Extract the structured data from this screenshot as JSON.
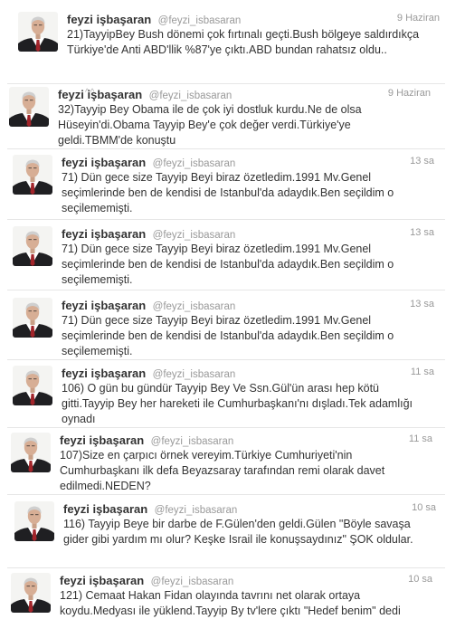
{
  "colors": {
    "name": "#333333",
    "handle": "#999999",
    "text": "#333333",
    "divider": "#e6e6e6"
  },
  "tweets": [
    {
      "name": "feyzi işbaşaran",
      "handle": "@feyzi_isbasaran",
      "time": "9 Haziran",
      "text": "21)TayyipBey Bush dönemi çok fırtınalı geçti.Bush bölgeye saldırdıkça Türkiye'de Anti ABD'llik %87'ye çıktı.ABD bundan rahatsız oldu..",
      "expand": "^^"
    },
    {
      "name": "feyzi işbaşaran",
      "handle": "@feyzi_isbasaran",
      "time": "9 Haziran",
      "text": "32)Tayyip Bey Obama ile de çok iyi dostluk kurdu.Ne de olsa Hüseyin'di.Obama Tayyip Bey'e çok değer verdi.Türkiye'ye geldi.TBMM'de konuştu"
    },
    {
      "name": "feyzi işbaşaran",
      "handle": "@feyzi_isbasaran",
      "time": "13 sa",
      "text": "71) Dün gece size Tayyip Beyi biraz özetledim.1991 Mv.Genel seçimlerinde ben de kendisi de Istanbul'da adaydık.Ben seçildim o seçilememişti."
    },
    {
      "name": "feyzi işbaşaran",
      "handle": "@feyzi_isbasaran",
      "time": "13 sa",
      "text": "71) Dün gece size Tayyip Beyi biraz özetledim.1991 Mv.Genel seçimlerinde ben de kendisi de Istanbul'da adaydık.Ben seçildim o seçilememişti."
    },
    {
      "name": "feyzi işbaşaran",
      "handle": "@feyzi_isbasaran",
      "time": "13 sa",
      "text": "71) Dün gece size Tayyip Beyi biraz özetledim.1991 Mv.Genel seçimlerinde ben de kendisi de Istanbul'da adaydık.Ben seçildim o seçilememişti."
    },
    {
      "name": "feyzi işbaşaran",
      "handle": "@feyzi_isbasaran",
      "time": "11 sa",
      "text": "106) O gün bu gündür Tayyip Bey Ve Ssn.Gül'ün arası hep kötü gitti.Tayyip Bey her hareketi ile Cumhurbaşkanı'nı dışladı.Tek adamlığı oynadı"
    },
    {
      "name": "feyzi işbaşaran",
      "handle": "@feyzi_isbasaran",
      "time": "11 sa",
      "text": "107)Size en çarpıcı örnek vereyim.Türkiye Cumhuriyeti'nin Cumhurbaşkanı ilk defa Beyazsaray tarafından remi olarak davet edilmedi.NEDEN?"
    },
    {
      "name": "feyzi işbaşaran",
      "handle": "@feyzi_isbasaran",
      "time": "10 sa",
      "text": "116) Tayyip Beye bir darbe de F.Gülen'den geldi.Gülen \"Böyle savaşa gider gibi yardım mı olur? Keşke Israil ile konuşsaydınız\" ŞOK oldular."
    },
    {
      "name": "feyzi işbaşaran",
      "handle": "@feyzi_isbasaran",
      "time": "10 sa",
      "text": "121) Cemaat Hakan Fidan olayında tavrını net olarak ortaya koydu.Medyası ile yüklend.Tayyip By tv'lere çıktı \"Hedef benim\" dedi"
    }
  ]
}
